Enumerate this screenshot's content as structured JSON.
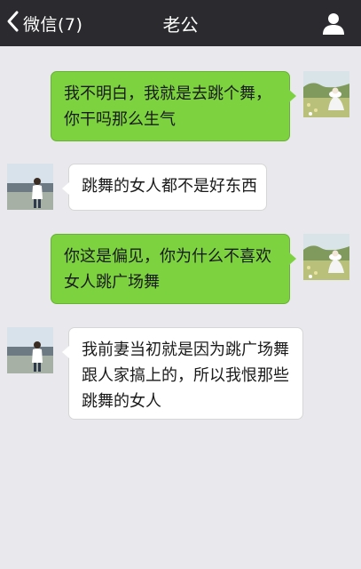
{
  "header": {
    "back_label": "微信(7)",
    "title": "老公"
  },
  "messages": [
    {
      "sender": "me",
      "lines": [
        "我不明白，我就是去跳个舞，",
        "你干吗那么生气"
      ]
    },
    {
      "sender": "other",
      "lines": [
        "跳舞的女人都不是好东西"
      ]
    },
    {
      "sender": "me",
      "lines": [
        "你这是偏见，你为什么不喜欢",
        "女人跳广场舞"
      ]
    },
    {
      "sender": "other",
      "lines": [
        "我前妻当初就是因为跳广场舞",
        "跟人家搞上的，所以我恨那些",
        "跳舞的女人"
      ]
    }
  ],
  "colors": {
    "header_bg": "#2b2b2f",
    "chat_bg": "#e9e8ed",
    "my_bubble": "#7cd23f",
    "other_bubble": "#ffffff"
  },
  "icons": {
    "back": "chevron-left-icon",
    "profile": "person-icon"
  }
}
